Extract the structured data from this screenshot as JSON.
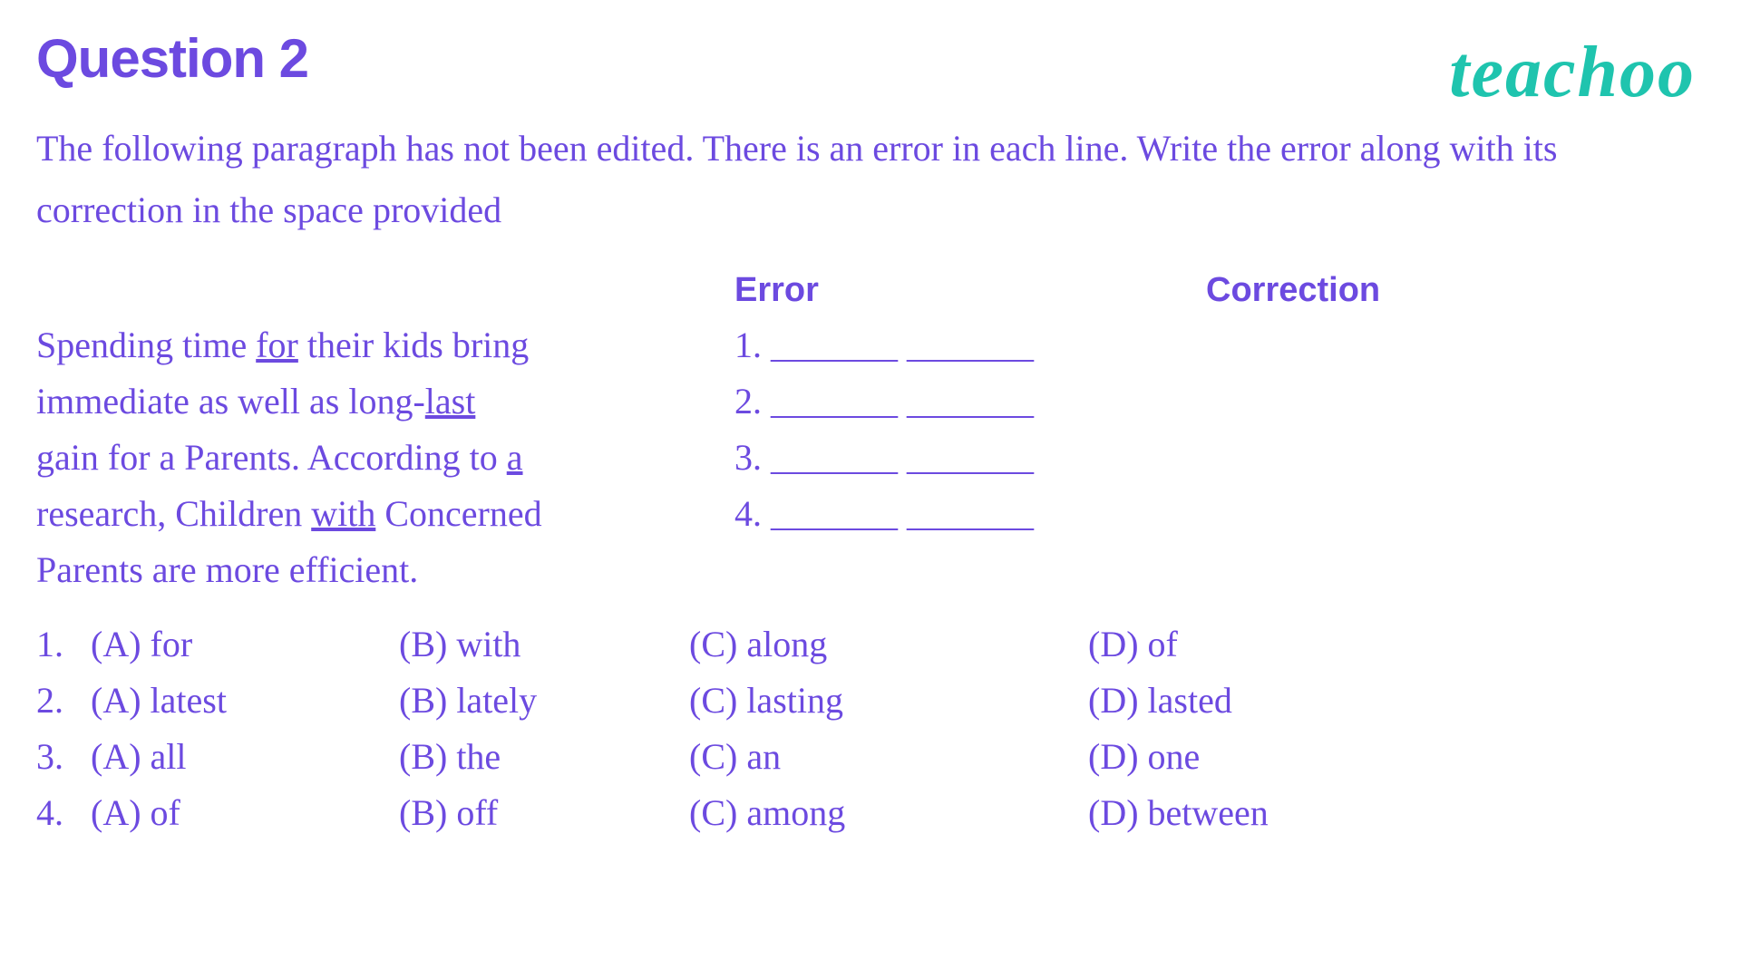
{
  "title": "Question 2",
  "logo": "teachoo",
  "instruction": "The following paragraph has not been edited. There is an error in each line. Write the error along  with its correction in the space provided",
  "headers": {
    "error": "Error",
    "correction": "Correction"
  },
  "paragraph": {
    "line1_pre": "Spending time ",
    "line1_u": "for",
    "line1_post": " their kids bring",
    "line2_pre": "immediate as well as long-",
    "line2_u": "last",
    "line2_post": "",
    "line3_pre": "gain for a Parents. According to ",
    "line3_u": "a",
    "line3_post": "",
    "line4_pre": "research, Children ",
    "line4_u": "with",
    "line4_post": " Concerned",
    "line5": "Parents are more efficient."
  },
  "blanks": {
    "row1": "1.   _______  _______",
    "row2": "2.  _______  _______",
    "row3": "3.  _______  _______",
    "row4": "4.  _______  _______"
  },
  "options": [
    {
      "num": "1.",
      "a": "(A) for",
      "b": "(B) with",
      "c": "(C) along",
      "d": "(D) of"
    },
    {
      "num": "2.",
      "a": "(A) latest",
      "b": "(B) lately",
      "c": "(C) lasting",
      "d": "(D) lasted"
    },
    {
      "num": "3.",
      "a": "(A) all",
      "b": "(B) the",
      "c": "(C) an",
      "d": "(D) one"
    },
    {
      "num": "4.",
      "a": "(A) of",
      "b": "(B) off",
      "c": "(C) among",
      "d": "(D) between"
    }
  ]
}
